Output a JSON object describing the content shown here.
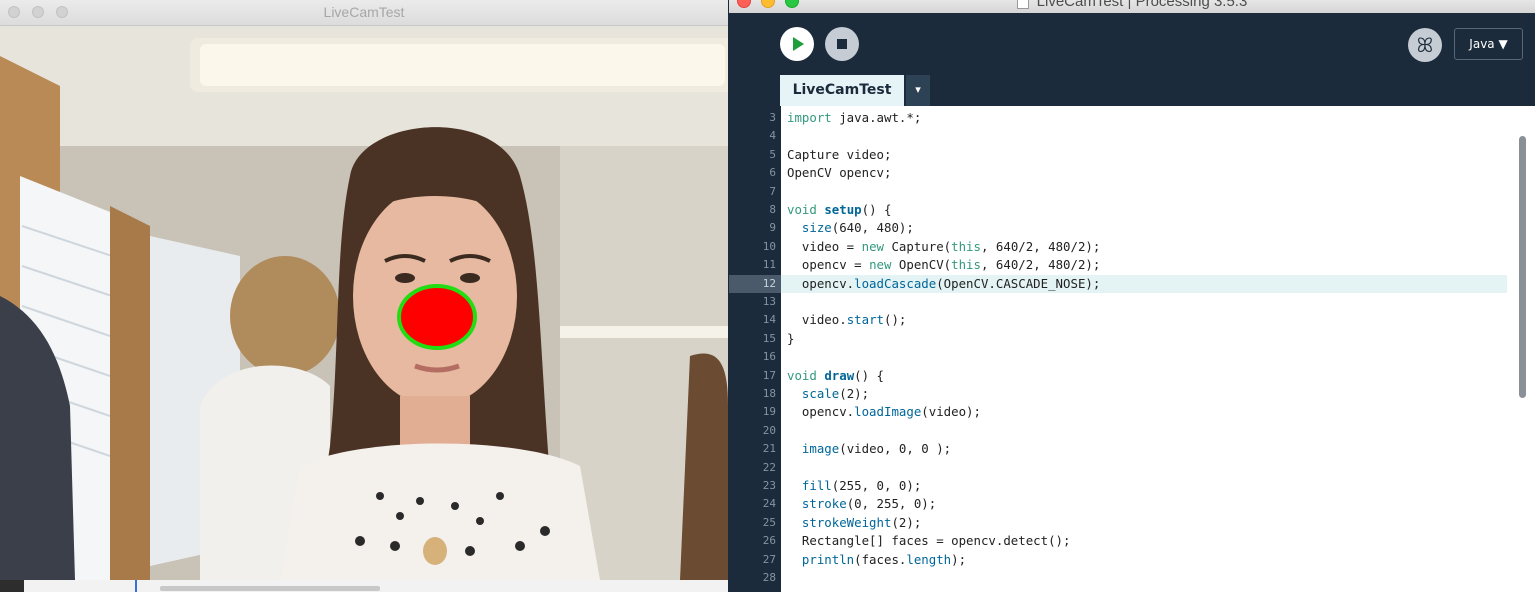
{
  "camera_window": {
    "title": "LiveCamTest",
    "overlay": {
      "fill": "#ff0000",
      "stroke": "#22dd11"
    }
  },
  "ide_window": {
    "title": "LiveCamTest | Processing 3.5.3",
    "toolbar": {
      "run_icon": "play-icon",
      "stop_icon": "stop-icon",
      "debug_icon": "debug-butterfly-icon",
      "debug_glyph": "ꕤ",
      "mode_label": "Java ▼"
    },
    "tab": {
      "label": "LiveCamTest",
      "menu_glyph": "▾"
    },
    "current_line": 12,
    "code": [
      {
        "n": "3",
        "t": "import java.awt.*;"
      },
      {
        "n": "4",
        "t": ""
      },
      {
        "n": "5",
        "t": "Capture video;"
      },
      {
        "n": "6",
        "t": "OpenCV opencv;"
      },
      {
        "n": "7",
        "t": ""
      },
      {
        "n": "8",
        "t": "void setup() {"
      },
      {
        "n": "9",
        "t": "  size(640, 480);"
      },
      {
        "n": "10",
        "t": "  video = new Capture(this, 640/2, 480/2);"
      },
      {
        "n": "11",
        "t": "  opencv = new OpenCV(this, 640/2, 480/2);"
      },
      {
        "n": "12",
        "t": "  opencv.loadCascade(OpenCV.CASCADE_NOSE);"
      },
      {
        "n": "13",
        "t": ""
      },
      {
        "n": "14",
        "t": "  video.start();"
      },
      {
        "n": "15",
        "t": "}"
      },
      {
        "n": "16",
        "t": ""
      },
      {
        "n": "17",
        "t": "void draw() {"
      },
      {
        "n": "18",
        "t": "  scale(2);"
      },
      {
        "n": "19",
        "t": "  opencv.loadImage(video);"
      },
      {
        "n": "20",
        "t": ""
      },
      {
        "n": "21",
        "t": "  image(video, 0, 0 );"
      },
      {
        "n": "22",
        "t": ""
      },
      {
        "n": "23",
        "t": "  fill(255, 0, 0);"
      },
      {
        "n": "24",
        "t": "  stroke(0, 255, 0);"
      },
      {
        "n": "25",
        "t": "  strokeWeight(2);"
      },
      {
        "n": "26",
        "t": "  Rectangle[] faces = opencv.detect();"
      },
      {
        "n": "27",
        "t": "  println(faces.length);"
      },
      {
        "n": "28",
        "t": ""
      }
    ]
  }
}
